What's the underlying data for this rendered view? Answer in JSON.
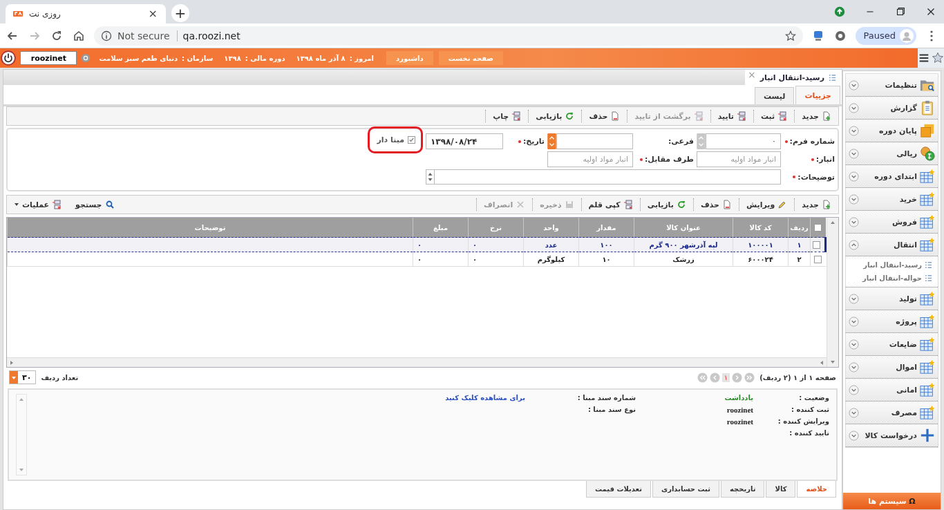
{
  "browser": {
    "tab_title": "روزی نت",
    "tab_close": "×",
    "new_tab": "+",
    "not_secure": "Not secure",
    "url": "qa.roozi.net",
    "profile": "Paused"
  },
  "header": {
    "user": "roozinet",
    "buttons": [
      "صفحه نخست",
      "داشبورد"
    ],
    "info": [
      {
        "label": "امروز :",
        "value": "۸ آذر ماه ۱۳۹۸"
      },
      {
        "label": "دوره مالی :",
        "value": "۱۳۹۸"
      },
      {
        "label": "سازمان :",
        "value": "دنیای طعم سبز سلامت"
      }
    ]
  },
  "document": {
    "title": "رسید-انتقال انبار",
    "close": "×",
    "tabs": [
      {
        "label": "جزییات",
        "selected": true
      },
      {
        "label": "لیست",
        "selected": false
      }
    ],
    "toolbar": [
      {
        "kind": "new",
        "label": "جدید",
        "disabled": false
      },
      {
        "kind": "save",
        "label": "ثبت",
        "disabled": false
      },
      {
        "kind": "confirm",
        "label": "تایید",
        "disabled": false
      },
      {
        "kind": "unconfirm",
        "label": "برگشت از تایید",
        "disabled": true
      },
      {
        "kind": "delete",
        "label": "حذف",
        "disabled": false
      },
      {
        "kind": "restore",
        "label": "بازیابی",
        "disabled": false
      },
      {
        "kind": "print",
        "label": "چاپ",
        "disabled": false
      }
    ],
    "form": {
      "form_number": {
        "label": "شماره فرم:",
        "required": true,
        "value": "۰",
        "spinner_disabled": true
      },
      "sub": {
        "label": "فرعی:",
        "required": false,
        "spinner_disabled": false
      },
      "date": {
        "label": "تاریخ:",
        "required": true,
        "value": "۱۳۹۸/۰۸/۲۴"
      },
      "based": {
        "label": "مبنا دار",
        "checked": true,
        "highlighted": true
      },
      "warehouse": {
        "label": "انبار:",
        "required": true,
        "placeholder": "انبار مواد اولیه"
      },
      "counterpart": {
        "label": "طرف مقابل:",
        "required": true,
        "placeholder": "انبار مواد اولیه"
      },
      "notes": {
        "label": "توضیحات:",
        "required": true
      }
    },
    "grid": {
      "toolbar": [
        {
          "kind": "new",
          "label": "جدید",
          "disabled": false
        },
        {
          "kind": "edit",
          "label": "ویرایش",
          "disabled": false
        },
        {
          "kind": "delete",
          "label": "حذف",
          "disabled": false
        },
        {
          "kind": "restore",
          "label": "بازیابی",
          "disabled": false
        },
        {
          "kind": "copy",
          "label": "کپی قلم",
          "disabled": false
        },
        {
          "kind": "store",
          "label": "ذخیره",
          "disabled": true
        },
        {
          "kind": "cancel",
          "label": "انصراف",
          "disabled": true
        }
      ],
      "tools_end": [
        {
          "kind": "search",
          "label": "جستجو",
          "dropdown": false
        },
        {
          "kind": "ops",
          "label": "عملیات",
          "dropdown": true
        }
      ],
      "all_checked": false,
      "columns": [
        "ردیف",
        "کد کالا",
        "عنوان کالا",
        "مقدار",
        "واحد",
        "نرخ",
        "مبلغ",
        "توضیحات"
      ],
      "rows": [
        {
          "selected": true,
          "checked": false,
          "cells": [
            "۱",
            "۱۰۰۰۰۱",
            "لپه آذرشهر ۹۰۰ گرم",
            "۱۰۰",
            "عدد",
            "۰",
            "۰"
          ]
        },
        {
          "selected": false,
          "checked": false,
          "cells": [
            "۲",
            "۶۰۰۰۲۴",
            "زرشک",
            "۱۰",
            "کیلوگرم",
            "۰",
            "۰"
          ]
        }
      ],
      "pager": {
        "summary": "صفحه ۱ از ۱ (۲ ردیف)",
        "current_page": "۱",
        "rows_label": "تعداد ردیف",
        "rows_value": "۳۰"
      }
    },
    "summary": {
      "fields": [
        {
          "label": "وضعیت :",
          "value": "یادداشت",
          "kind": "status"
        },
        {
          "label": "ثبت کننده :",
          "value": "roozinet",
          "kind": "user"
        },
        {
          "label": "ویرایش کننده :",
          "value": "roozinet",
          "kind": "user"
        },
        {
          "label": "تایید کننده :"
        }
      ],
      "ref_fields": [
        {
          "label": "شماره سند مبنا :",
          "value": "برای مشاهده کلیک کنید",
          "kind": "link"
        },
        {
          "label": "نوع سند مبنا :"
        }
      ]
    },
    "bottom_tabs": [
      {
        "label": "خلاصه",
        "selected": true
      },
      {
        "label": "کالا",
        "selected": false
      },
      {
        "label": "تاریخچه",
        "selected": false
      },
      {
        "label": "ثبت حسابداری",
        "selected": false
      },
      {
        "label": "تعدیلات قیمت",
        "selected": false
      }
    ]
  },
  "sidebar": {
    "items": [
      {
        "kind": "folder",
        "label": "تنظیمات",
        "expanded": false
      },
      {
        "kind": "report",
        "label": "گزارش",
        "expanded": false
      },
      {
        "kind": "stack",
        "label": "پایان دوره",
        "expanded": false
      },
      {
        "kind": "coins",
        "label": "ریالی",
        "expanded": false
      },
      {
        "kind": "table",
        "label": "ابتدای دوره",
        "expanded": false
      },
      {
        "kind": "table",
        "label": "خرید",
        "expanded": false
      },
      {
        "kind": "table",
        "label": "فروش",
        "expanded": false
      },
      {
        "kind": "table",
        "label": "انتقال",
        "expanded": true,
        "children": [
          {
            "label": "رسید-انتقال انبار"
          },
          {
            "label": "حواله-انتقال انبار"
          }
        ]
      },
      {
        "kind": "table",
        "label": "تولید",
        "expanded": false
      },
      {
        "kind": "table",
        "label": "پروژه",
        "expanded": false
      },
      {
        "kind": "table",
        "label": "ضایعات",
        "expanded": false
      },
      {
        "kind": "table",
        "label": "اموال",
        "expanded": false
      },
      {
        "kind": "table",
        "label": "امانی",
        "expanded": false
      },
      {
        "kind": "table",
        "label": "مصرف",
        "expanded": false
      },
      {
        "kind": "plus",
        "label": "درخواست کالا",
        "expanded": false
      }
    ],
    "systems": {
      "glyph": "Ω",
      "label": "سیستم ها"
    }
  }
}
